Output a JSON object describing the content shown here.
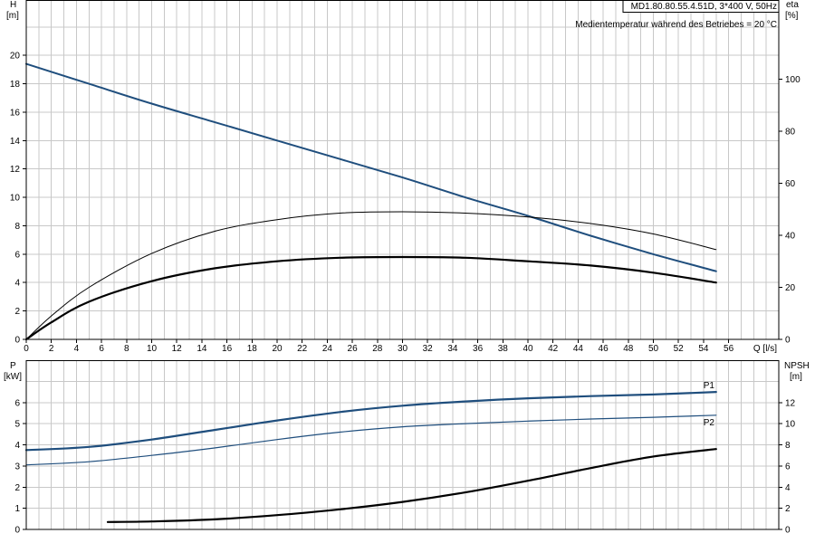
{
  "header": {
    "model": "MD1.80.80.55.4.51D, 3*400 V, 50Hz",
    "note": "Medientemperatur während des Betriebes = 20 °C"
  },
  "colors": {
    "blue": "#1f4e7d",
    "black": "#000000",
    "grid": "#c8c8c8"
  },
  "chart_data": [
    {
      "type": "line",
      "title": "MD1.80.80.55.4.51D, 3*400 V, 50Hz",
      "subtitle": "Medientemperatur während des Betriebes = 20 °C",
      "xlabel": "Q [l/s]",
      "x_axis_label": "Q",
      "x_axis_unit": "[l/s]",
      "ylabel_left": "H",
      "ylabel_left_unit": "[m]",
      "ylabel_right": "eta",
      "ylabel_right_unit": "[%]",
      "xlim": [
        0,
        60
      ],
      "ylim_left": [
        0,
        22
      ],
      "ylim_right": [
        0,
        120
      ],
      "x_ticks": [
        0,
        2,
        4,
        6,
        8,
        10,
        12,
        14,
        16,
        18,
        20,
        22,
        24,
        26,
        28,
        30,
        32,
        34,
        36,
        38,
        40,
        42,
        44,
        46,
        48,
        50,
        52,
        54,
        56
      ],
      "y_ticks_left": [
        0,
        2,
        4,
        6,
        8,
        10,
        12,
        14,
        16,
        18,
        20
      ],
      "y_ticks_right": [
        0,
        20,
        40,
        60,
        80,
        100
      ],
      "grid": true,
      "series": [
        {
          "axis": "left",
          "color": "#1f4e7d",
          "width": 2,
          "x": [
            0,
            5,
            10,
            15,
            20,
            25,
            30,
            35,
            40,
            45,
            50,
            55
          ],
          "y": [
            19.4,
            18.0,
            16.6,
            15.3,
            14.0,
            12.7,
            11.4,
            10.0,
            8.7,
            7.3,
            6.0,
            4.8
          ]
        },
        {
          "axis": "right",
          "color": "#000000",
          "width": 1,
          "x": [
            0,
            2,
            5,
            10,
            15,
            20,
            25,
            30,
            35,
            40,
            45,
            50,
            55
          ],
          "y": [
            0,
            9,
            20,
            33,
            41.5,
            46,
            48.5,
            49,
            48.5,
            47,
            44.5,
            40.5,
            34.5
          ]
        },
        {
          "axis": "left",
          "color": "#000000",
          "width": 2.2,
          "x": [
            0,
            2,
            5,
            10,
            15,
            20,
            25,
            30,
            35,
            40,
            45,
            50,
            55
          ],
          "y": [
            0,
            1.2,
            2.65,
            4.1,
            5.0,
            5.5,
            5.75,
            5.8,
            5.75,
            5.5,
            5.2,
            4.7,
            4.0
          ]
        }
      ]
    },
    {
      "type": "line",
      "xlabel": "",
      "ylabel_left": "P",
      "ylabel_left_unit": "[kW]",
      "ylabel_right": "NPSH",
      "ylabel_right_unit": "[m]",
      "xlim": [
        0,
        60
      ],
      "ylim_left": [
        0,
        8
      ],
      "ylim_right": [
        0,
        16
      ],
      "x_ticks": [],
      "y_ticks_left": [
        0,
        1,
        2,
        3,
        4,
        5,
        6
      ],
      "y_ticks_right": [
        0,
        2,
        4,
        6,
        8,
        10,
        12
      ],
      "grid": true,
      "series": [
        {
          "name": "P1",
          "axis": "left",
          "color": "#1f4e7d",
          "width": 2.2,
          "x": [
            0,
            5,
            10,
            15,
            20,
            25,
            30,
            35,
            40,
            45,
            50,
            55
          ],
          "y": [
            3.75,
            3.9,
            4.25,
            4.7,
            5.15,
            5.55,
            5.85,
            6.05,
            6.2,
            6.3,
            6.38,
            6.5
          ]
        },
        {
          "name": "P2",
          "axis": "left",
          "color": "#1f4e7d",
          "width": 1.2,
          "x": [
            0,
            5,
            10,
            15,
            20,
            25,
            30,
            35,
            40,
            45,
            50,
            55
          ],
          "y": [
            3.05,
            3.2,
            3.5,
            3.85,
            4.25,
            4.6,
            4.85,
            5.0,
            5.12,
            5.22,
            5.3,
            5.4
          ]
        },
        {
          "axis": "right",
          "color": "#000000",
          "width": 2.2,
          "x": [
            6.5,
            10,
            15,
            20,
            25,
            30,
            35,
            40,
            45,
            50,
            55
          ],
          "y": [
            0.7,
            0.75,
            0.95,
            1.35,
            1.9,
            2.6,
            3.5,
            4.6,
            5.8,
            6.9,
            7.6
          ]
        }
      ]
    }
  ]
}
